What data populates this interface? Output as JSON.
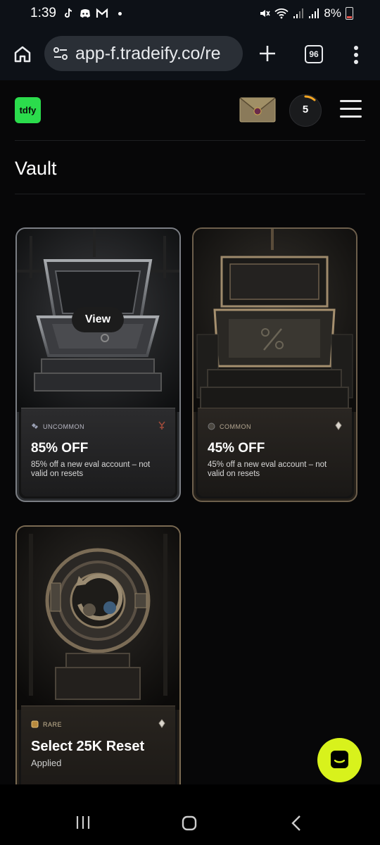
{
  "status_bar": {
    "time": "1:39",
    "battery": "8%"
  },
  "browser": {
    "url": "app-f.tradeify.co/re",
    "tab_count": "96"
  },
  "header": {
    "logo_text": "tdfy",
    "streak_count": "5"
  },
  "page": {
    "title": "Vault"
  },
  "cards": [
    {
      "rarity": "UNCOMMON",
      "title": "85% OFF",
      "description": "85% off a new eval account – not valid on resets",
      "view_label": "View",
      "rarity_color": "#8c8c99"
    },
    {
      "rarity": "COMMON",
      "title": "45% OFF",
      "description": "45% off a new eval account – not valid on resets",
      "rarity_color": "#9c8e7c"
    },
    {
      "rarity": "RARE",
      "title": "Select 25K Reset",
      "description": "Applied",
      "rarity_color": "#c29a5b"
    }
  ],
  "colors": {
    "accent_green": "#2bdc4c",
    "chat_yellow": "#d8f21c",
    "streak_arc": "#f5a623"
  },
  "icons": [
    "home-icon",
    "site-settings-icon",
    "plus-icon",
    "tabs-icon",
    "more-icon",
    "envelope-icon",
    "hamburger-icon",
    "chat-icon",
    "recent-apps-icon",
    "home-nav-icon",
    "back-icon"
  ]
}
